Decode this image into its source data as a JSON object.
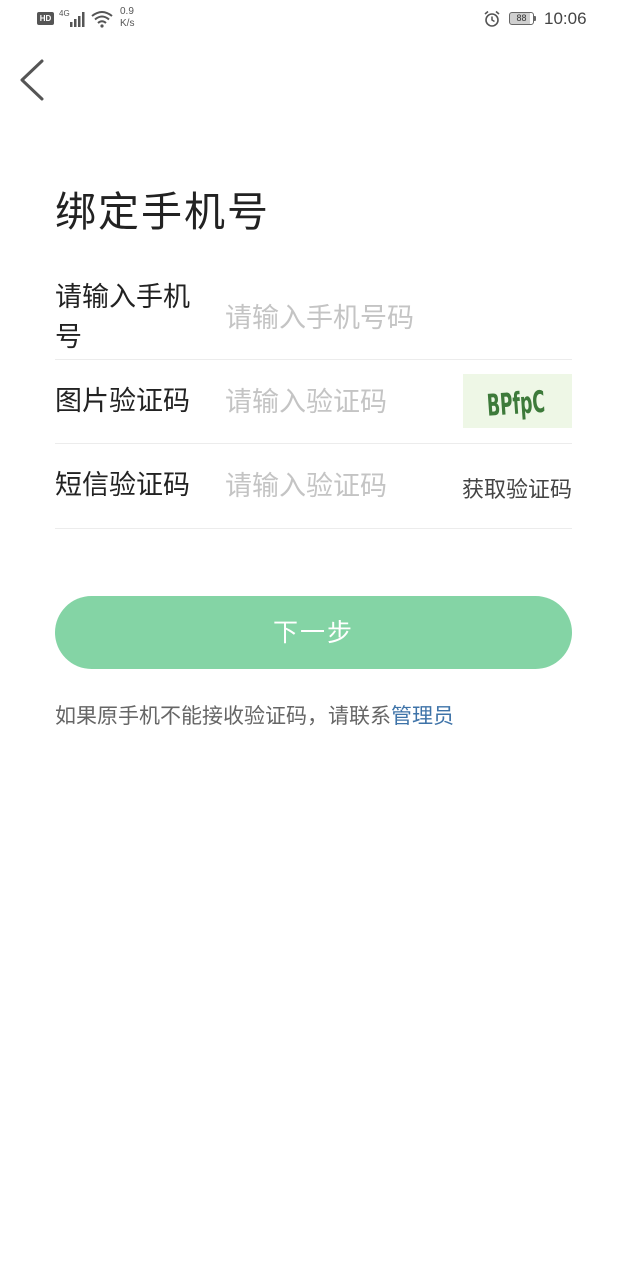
{
  "status_bar": {
    "hd_label": "HD",
    "network_type": "4G",
    "speed_value": "0.9",
    "speed_unit": "K/s",
    "battery_level": "88",
    "time": "10:06"
  },
  "header": {
    "back_icon": "chevron-left-icon"
  },
  "page": {
    "title": "绑定手机号"
  },
  "form": {
    "phone": {
      "label": "请输入手机号",
      "placeholder": "请输入手机号码",
      "value": ""
    },
    "captcha": {
      "label": "图片验证码",
      "placeholder": "请输入验证码",
      "value": "",
      "image_text": "BPfpC"
    },
    "sms": {
      "label": "短信验证码",
      "placeholder": "请输入验证码",
      "value": "",
      "get_code_label": "获取验证码"
    }
  },
  "next_button": {
    "label": "下一步",
    "color": "#84d4a5"
  },
  "help": {
    "text": "如果原手机不能接收验证码，请联系",
    "link_text": "管理员",
    "link_color": "#3e73a8"
  }
}
